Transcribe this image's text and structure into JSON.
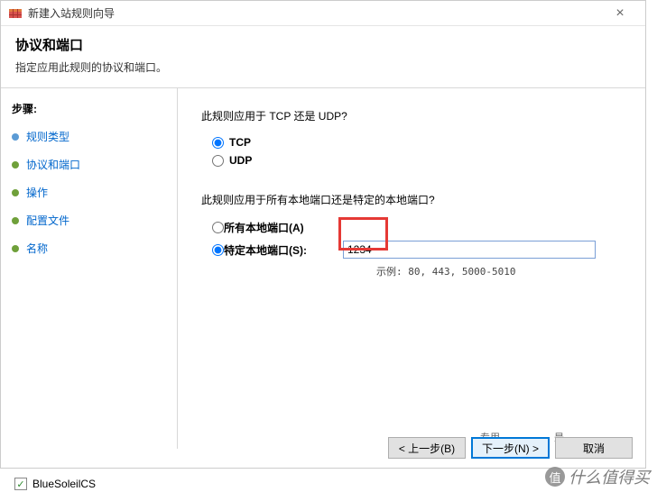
{
  "window": {
    "title": "新建入站规则向导",
    "close_glyph": "×"
  },
  "header": {
    "title": "协议和端口",
    "subtitle": "指定应用此规则的协议和端口。"
  },
  "sidebar": {
    "steps_label": "步骤:",
    "items": [
      {
        "label": "规则类型",
        "kind": "link"
      },
      {
        "label": "协议和端口",
        "kind": "current"
      },
      {
        "label": "操作",
        "kind": "step"
      },
      {
        "label": "配置文件",
        "kind": "step"
      },
      {
        "label": "名称",
        "kind": "step"
      }
    ]
  },
  "main": {
    "protocol_question": "此规则应用于 TCP 还是 UDP?",
    "tcp_label": "TCP",
    "udp_label": "UDP",
    "port_question": "此规则应用于所有本地端口还是特定的本地端口?",
    "all_ports_label": "所有本地端口(A)",
    "specific_ports_label": "特定本地端口(S):",
    "port_value": "1234",
    "port_example": "示例: 80, 443, 5000-5010"
  },
  "footer": {
    "back": "< 上一步(B)",
    "next": "下一步(N) >",
    "cancel": "取消",
    "col1": "专用",
    "col2": "是"
  },
  "bottom": {
    "check_glyph": "✓",
    "app_name": "BlueSoleilCS"
  },
  "watermark": {
    "icon_text": "值",
    "text": "什么值得买"
  }
}
